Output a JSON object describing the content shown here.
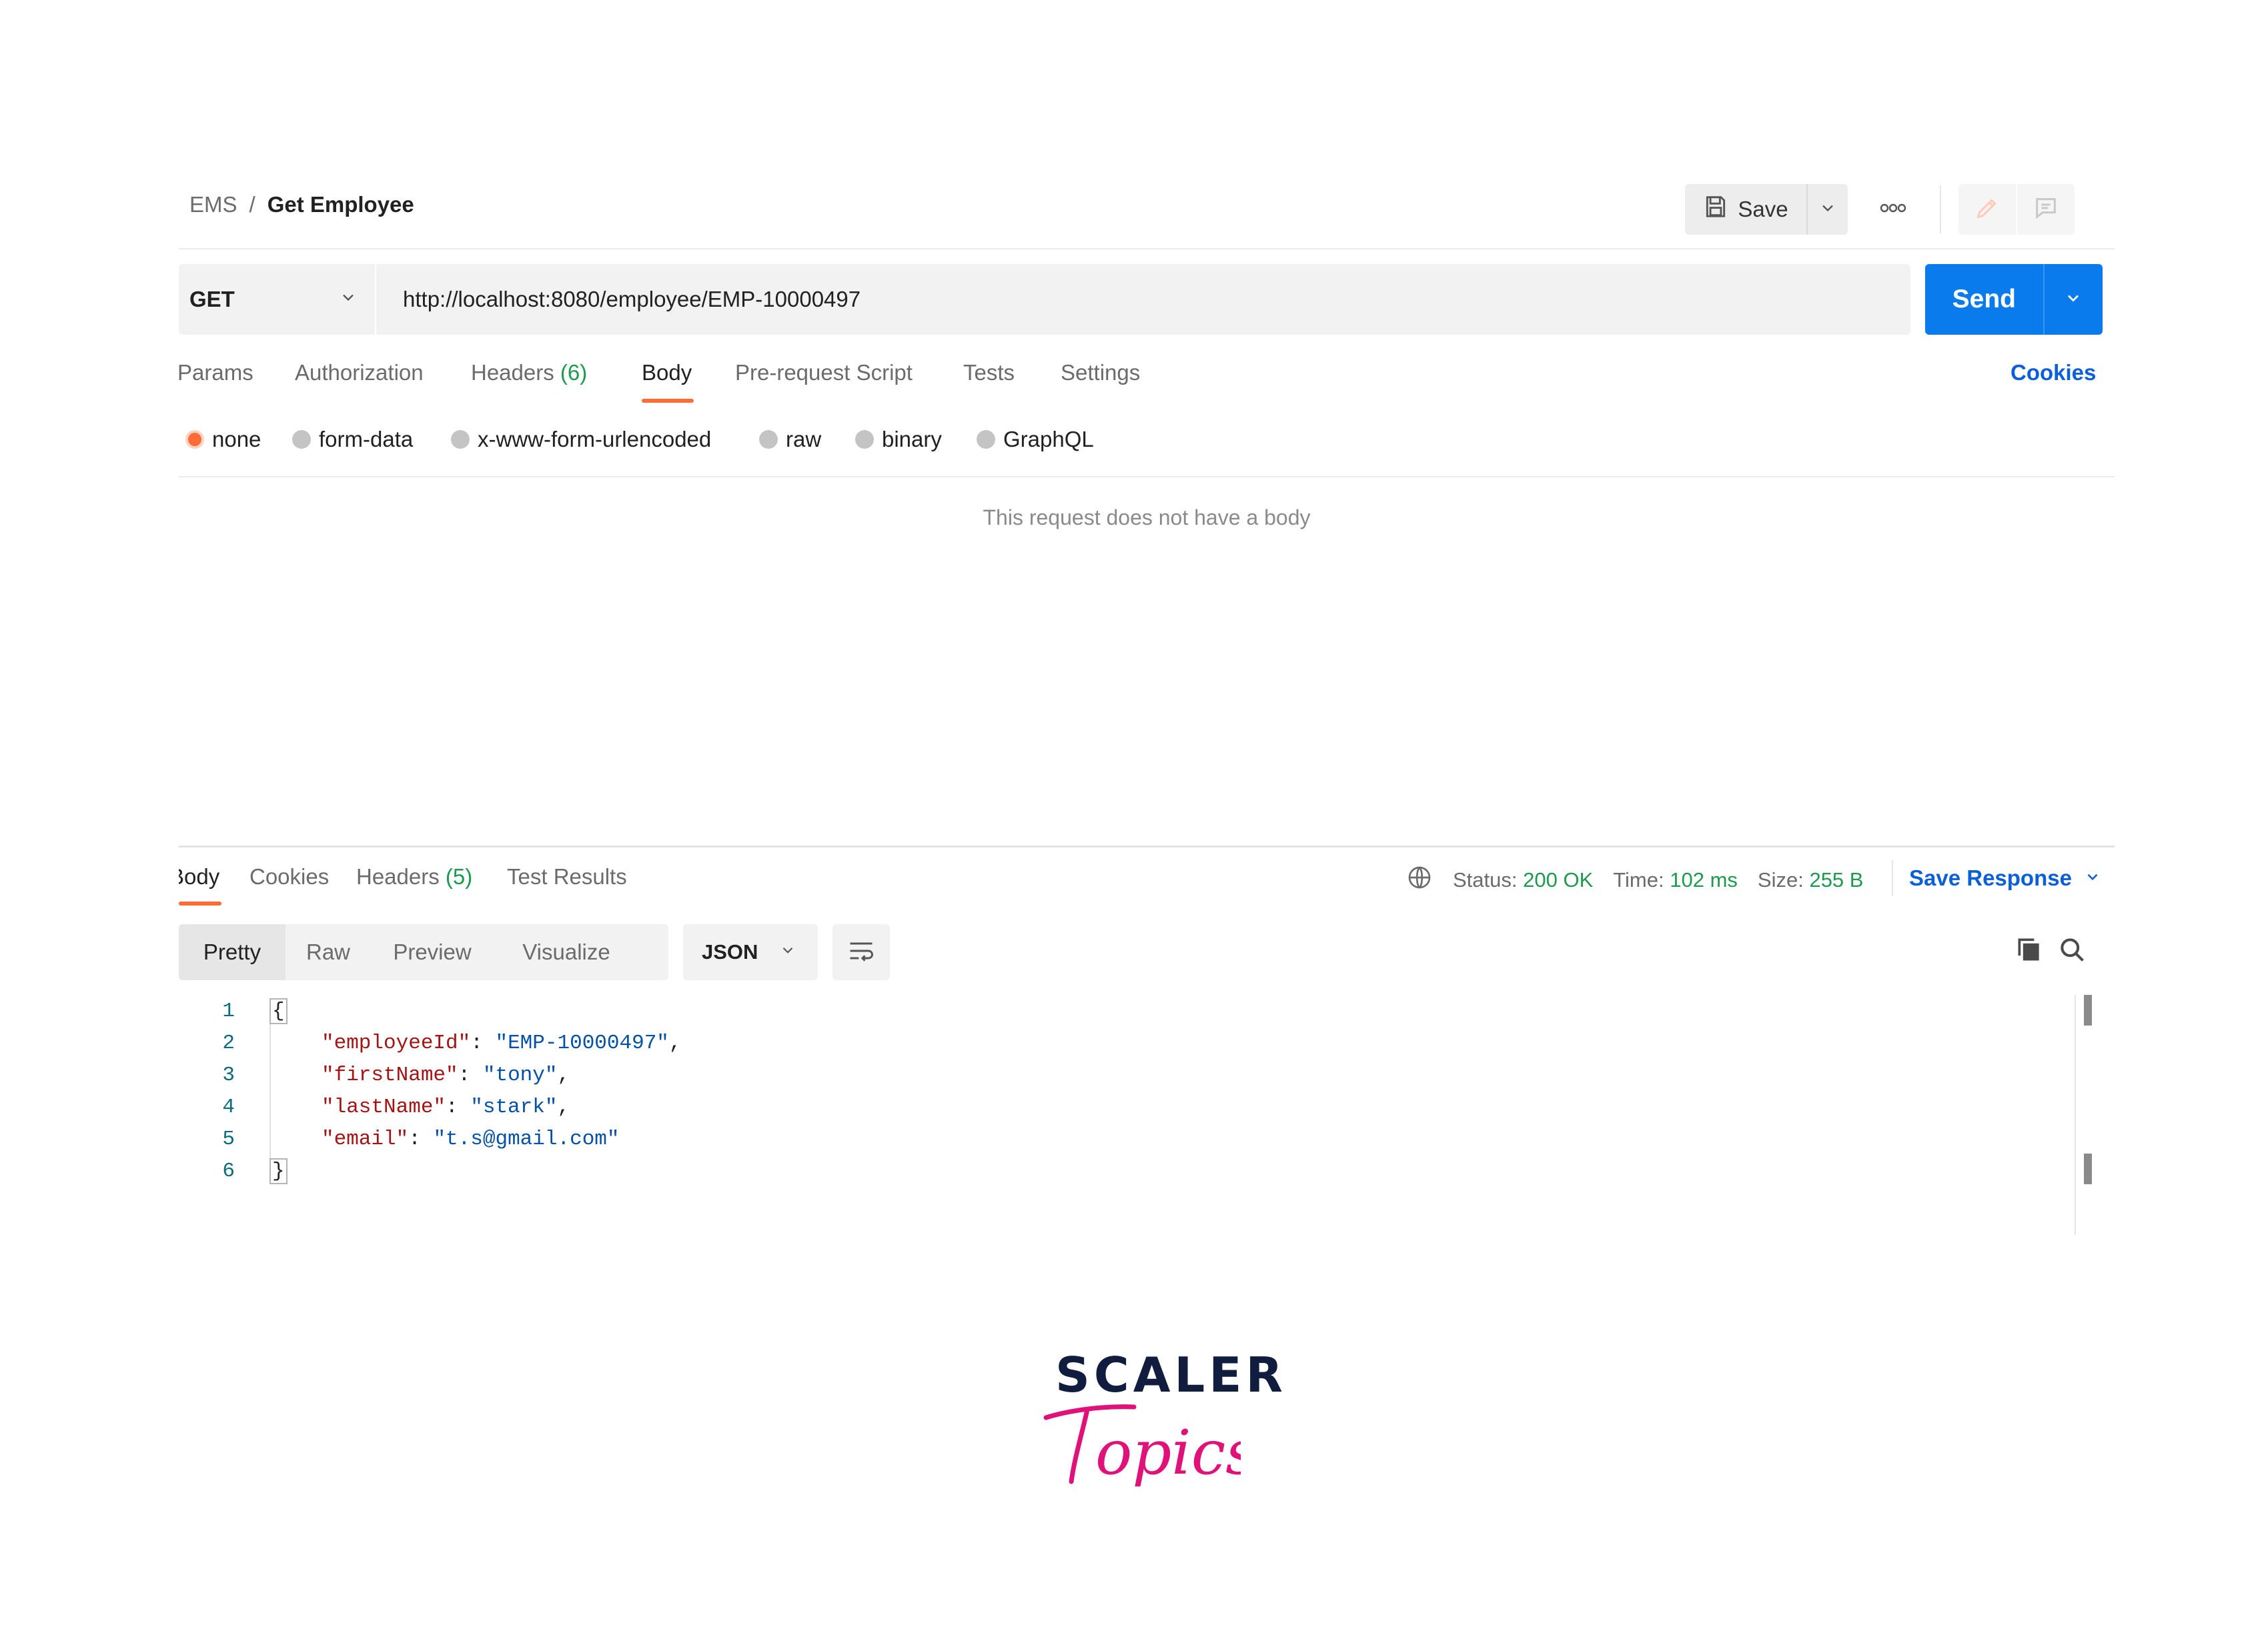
{
  "breadcrumb": {
    "parent": "EMS",
    "separator": "/",
    "current": "Get Employee"
  },
  "toolbar": {
    "save_label": "Save"
  },
  "request": {
    "method": "GET",
    "url": "http://localhost:8080/employee/EMP-10000497",
    "send_label": "Send",
    "tabs": [
      {
        "label": "Params"
      },
      {
        "label": "Authorization"
      },
      {
        "label": "Headers",
        "count": "(6)"
      },
      {
        "label": "Body"
      },
      {
        "label": "Pre-request Script"
      },
      {
        "label": "Tests"
      },
      {
        "label": "Settings"
      }
    ],
    "active_tab": "Body",
    "cookies_label": "Cookies",
    "body_types": [
      "none",
      "form-data",
      "x-www-form-urlencoded",
      "raw",
      "binary",
      "GraphQL"
    ],
    "selected_body_type": "none",
    "empty_body_message": "This request does not have a body"
  },
  "response": {
    "tabs": [
      {
        "label": "Body"
      },
      {
        "label": "Cookies"
      },
      {
        "label": "Headers",
        "count": "(5)"
      },
      {
        "label": "Test Results"
      }
    ],
    "active_tab": "Body",
    "status_label": "Status:",
    "status_value": "200 OK",
    "time_label": "Time:",
    "time_value": "102 ms",
    "size_label": "Size:",
    "size_value": "255 B",
    "save_response_label": "Save Response",
    "view_modes": [
      "Pretty",
      "Raw",
      "Preview",
      "Visualize"
    ],
    "active_view_mode": "Pretty",
    "format": "JSON",
    "code_lines": [
      {
        "n": "1",
        "text": "{"
      },
      {
        "n": "2",
        "key": "\"employeeId\"",
        "value": "\"EMP-10000497\"",
        "trail": ","
      },
      {
        "n": "3",
        "key": "\"firstName\"",
        "value": "\"tony\"",
        "trail": ","
      },
      {
        "n": "4",
        "key": "\"lastName\"",
        "value": "\"stark\"",
        "trail": ","
      },
      {
        "n": "5",
        "key": "\"email\"",
        "value": "\"t.s@gmail.com\"",
        "trail": ""
      },
      {
        "n": "6",
        "text": "}"
      }
    ]
  },
  "brand": {
    "word": "SCALER",
    "script": "Topics",
    "word_color": "#111d3f",
    "script_color": "#e0127a"
  },
  "colors": {
    "accent": "#ff6c37",
    "send": "#097bed",
    "link": "#0b5fd9",
    "success": "#1c9a4e"
  },
  "icons": [
    "save-icon",
    "chevron-down-icon",
    "more-icon",
    "pencil-icon",
    "comment-icon",
    "globe-icon",
    "wrap-lines-icon",
    "copy-icon",
    "search-icon"
  ]
}
